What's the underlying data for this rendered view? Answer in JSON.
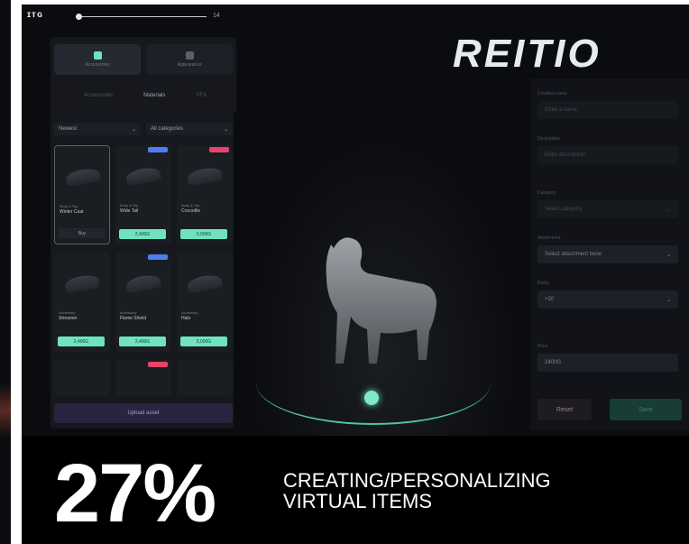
{
  "app": {
    "mark": "ɪᴛɢ",
    "slider_end": "14",
    "logo": "REITIO"
  },
  "left_panel": {
    "modes": [
      {
        "label": "Accessories",
        "active": true
      },
      {
        "label": "Appearance",
        "active": false
      }
    ],
    "sub_tabs": [
      "Accessories",
      "Materials",
      "VFX"
    ],
    "active_sub_tab": "Materials",
    "filters": [
      {
        "label": "Newest"
      },
      {
        "label": "All categories"
      }
    ],
    "cards": [
      {
        "type": "Body & Top",
        "name": "Winter Coat",
        "price": "Buy",
        "badge": "",
        "selected": true
      },
      {
        "type": "Body & Top",
        "name": "Wide Tail",
        "price": "2,400G",
        "badge": "#4f7ef0"
      },
      {
        "type": "Body & Top",
        "name": "Crocodile",
        "price": "3,000G",
        "badge": "#e8436b"
      },
      {
        "type": "Accessory",
        "name": "Streamer",
        "price": "2,400G",
        "badge": ""
      },
      {
        "type": "Accessory",
        "name": "Flame Shield",
        "price": "2,400G",
        "badge": "#4f7ef0"
      },
      {
        "type": "Accessory",
        "name": "Halo",
        "price": "3,000G",
        "badge": ""
      },
      {
        "type": "",
        "name": "",
        "price": "",
        "badge": ""
      },
      {
        "type": "",
        "name": "",
        "price": "",
        "badge": "#e8436b"
      },
      {
        "type": "",
        "name": "",
        "price": "",
        "badge": ""
      }
    ],
    "upload_label": "Upload asset"
  },
  "right_panel": {
    "fields": [
      {
        "label": "Creation name",
        "value": "Enter a name"
      },
      {
        "label": "Description",
        "value": "Enter description"
      },
      {
        "label": "Category",
        "value": "Select category"
      },
      {
        "label": "Attachment",
        "value": "Select attachment bone"
      },
      {
        "label": "Rarity",
        "value": "+20"
      },
      {
        "label": "Price",
        "value": "2400G"
      }
    ],
    "reset_label": "Reset",
    "save_label": "Save"
  },
  "banner": {
    "percent": "27%",
    "line1": "CREATING/PERSONALIZING",
    "line2": "VIRTUAL ITEMS"
  },
  "colors": {
    "accent": "#6fe3c1",
    "badge_blue": "#4f7ef0",
    "badge_pink": "#e8436b",
    "bg": "#0b0c0f"
  },
  "viewer": {
    "subject": "dog-3d-model"
  }
}
